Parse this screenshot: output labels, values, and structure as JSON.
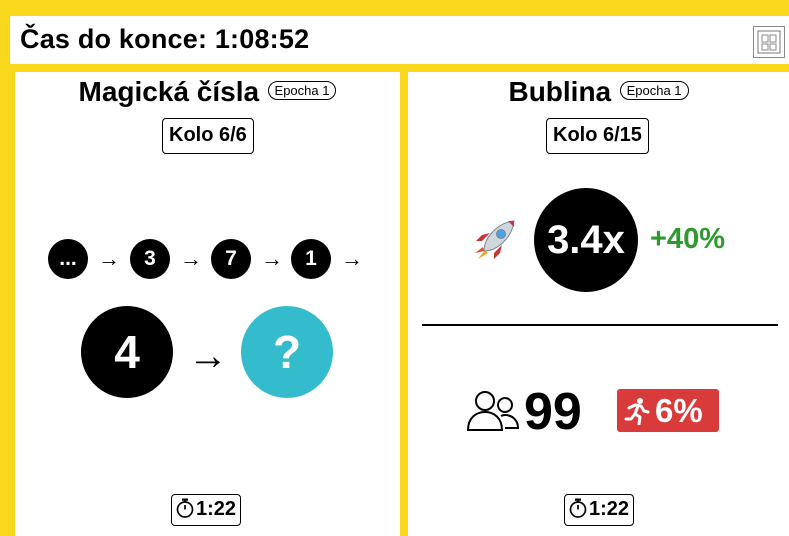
{
  "header": {
    "countdown": "Čas do konce: 1:08:52"
  },
  "left": {
    "title": "Magická čísla",
    "epoch": "Epocha 1",
    "round": "Kolo 6/6",
    "sequence": [
      "...",
      "3",
      "7",
      "1"
    ],
    "arrow": "→",
    "current": "4",
    "unknown": "?",
    "timer": "1:22",
    "colors": {
      "current": "#000000",
      "unknown": "#35bccc"
    }
  },
  "right": {
    "title": "Bublina",
    "epoch": "Epocha 1",
    "round": "Kolo 6/15",
    "rocket_icon": "rocket-icon",
    "multiplier": "3.4x",
    "change": "+40%",
    "players": "99",
    "exit_pct": "6%",
    "timer": "1:22",
    "colors": {
      "change": "#2e9a2e",
      "exit_badge": "#d93a3a"
    }
  }
}
